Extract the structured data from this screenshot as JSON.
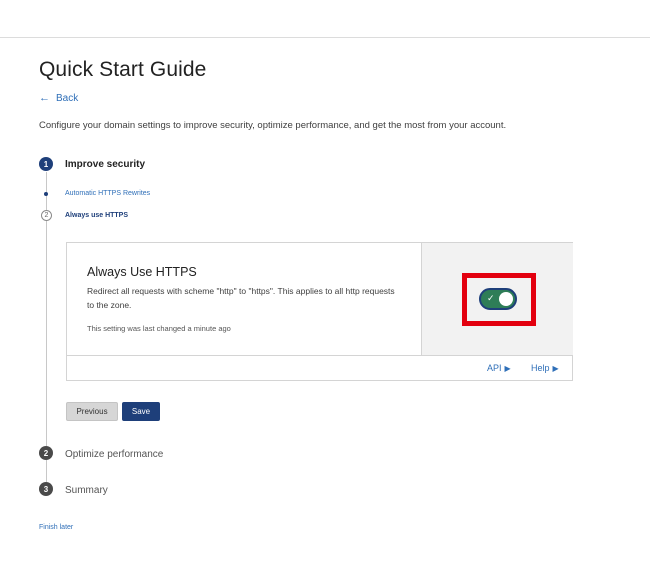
{
  "page": {
    "title": "Quick Start Guide",
    "back_label": "Back",
    "intro": "Configure your domain settings to improve security, optimize performance, and get the most from your account.",
    "finish_later": "Finish later"
  },
  "steps": [
    {
      "number": "1",
      "label": "Improve security",
      "state": "active"
    },
    {
      "number": "2",
      "label": "Optimize performance",
      "state": "pending"
    },
    {
      "number": "3",
      "label": "Summary",
      "state": "pending"
    }
  ],
  "substeps": [
    {
      "label": "Automatic HTTPS Rewrites",
      "state": "completed"
    },
    {
      "number": "2",
      "label": "Always use HTTPS",
      "state": "current"
    }
  ],
  "card": {
    "title": "Always Use HTTPS",
    "description": "Redirect all requests with scheme \"http\" to \"https\". This applies to all http requests to the zone.",
    "meta": "This setting was last changed a minute ago",
    "toggle_on": true,
    "toggle_color": "#2e7d57",
    "highlight_color": "#e3000f",
    "footer": {
      "api_label": "API",
      "help_label": "Help"
    }
  },
  "buttons": {
    "previous": "Previous",
    "save": "Save"
  },
  "colors": {
    "primary": "#1e3f7a",
    "link": "#2f6fb8"
  }
}
